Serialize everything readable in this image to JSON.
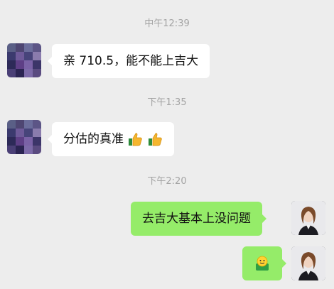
{
  "chat": {
    "timestamps": [
      "中午12:39",
      "下午1:35",
      "下午2:20"
    ],
    "messages": [
      {
        "side": "left",
        "text": "亲 710.5，能不能上吉大"
      },
      {
        "side": "left",
        "text": "分估的真准"
      },
      {
        "side": "right",
        "text": "去吉大基本上没问题"
      },
      {
        "side": "right",
        "text": ""
      }
    ],
    "icons": [
      "thumbs-up-icon",
      "thumbs-up-icon",
      "smiling-face-emoji"
    ]
  },
  "colors": {
    "background": "#ededed",
    "bubble_left": "#ffffff",
    "bubble_right": "#95ec69",
    "timestamp": "#a3a3a3"
  }
}
